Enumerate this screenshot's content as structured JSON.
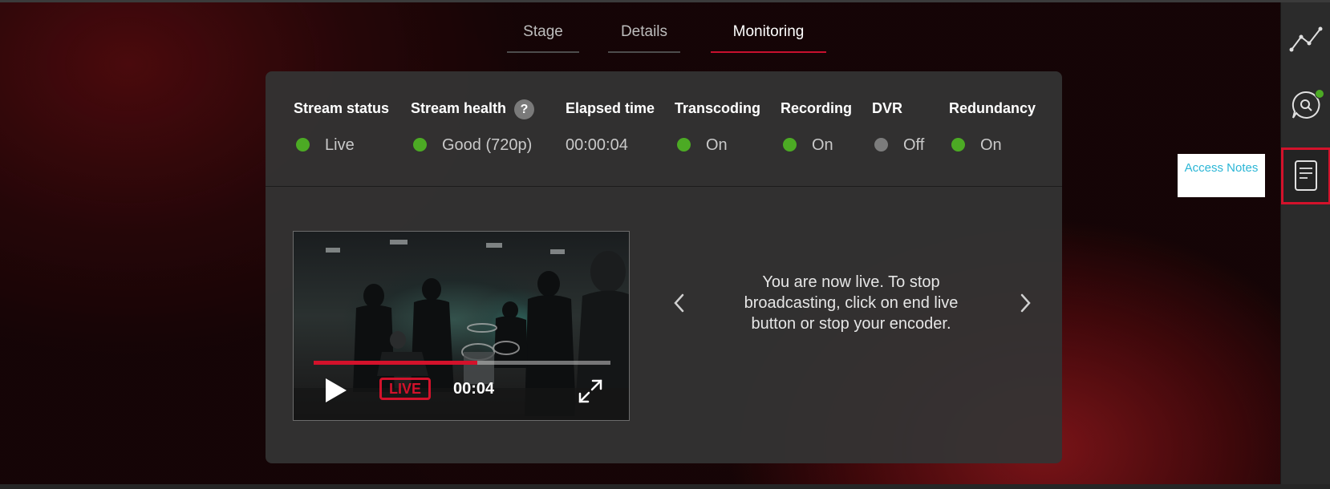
{
  "tabs": [
    {
      "label": "Stage",
      "active": false
    },
    {
      "label": "Details",
      "active": false
    },
    {
      "label": "Monitoring",
      "active": true
    }
  ],
  "status": {
    "stream_status": {
      "label": "Stream status",
      "value": "Live",
      "indicator": "#4caa24"
    },
    "stream_health": {
      "label": "Stream health",
      "help": "?",
      "value": "Good (720p)",
      "indicator": "#4caa24"
    },
    "elapsed_time": {
      "label": "Elapsed time",
      "value": "00:00:04"
    },
    "transcoding": {
      "label": "Transcoding",
      "value": "On",
      "indicator": "#4caa24"
    },
    "recording": {
      "label": "Recording",
      "value": "On",
      "indicator": "#4caa24"
    },
    "dvr": {
      "label": "DVR",
      "value": "Off",
      "indicator": "#7c7c7c"
    },
    "redundancy": {
      "label": "Redundancy",
      "value": "On",
      "indicator": "#4caa24"
    }
  },
  "player": {
    "live_badge": "LIVE",
    "time": "00:04",
    "progress": 0.55,
    "icons": {
      "play": "play-icon",
      "fullscreen": "fullscreen-icon"
    }
  },
  "carousel": {
    "message": "You are now live. To stop broadcasting, click on end live button or stop your encoder.",
    "icons": {
      "prev": "chevron-left-icon",
      "next": "chevron-right-icon"
    }
  },
  "sidebar": {
    "items": [
      {
        "icon": "analytics-chart-icon"
      },
      {
        "icon": "chat-search-icon",
        "notification": true
      },
      {
        "icon": "notes-icon",
        "highlighted": true
      }
    ]
  },
  "tooltip": {
    "text": "Access Notes"
  },
  "colors": {
    "accent": "#d3122b",
    "ok": "#4caa24",
    "off": "#7c7c7c",
    "tooltip_text": "#2bb6d6"
  }
}
